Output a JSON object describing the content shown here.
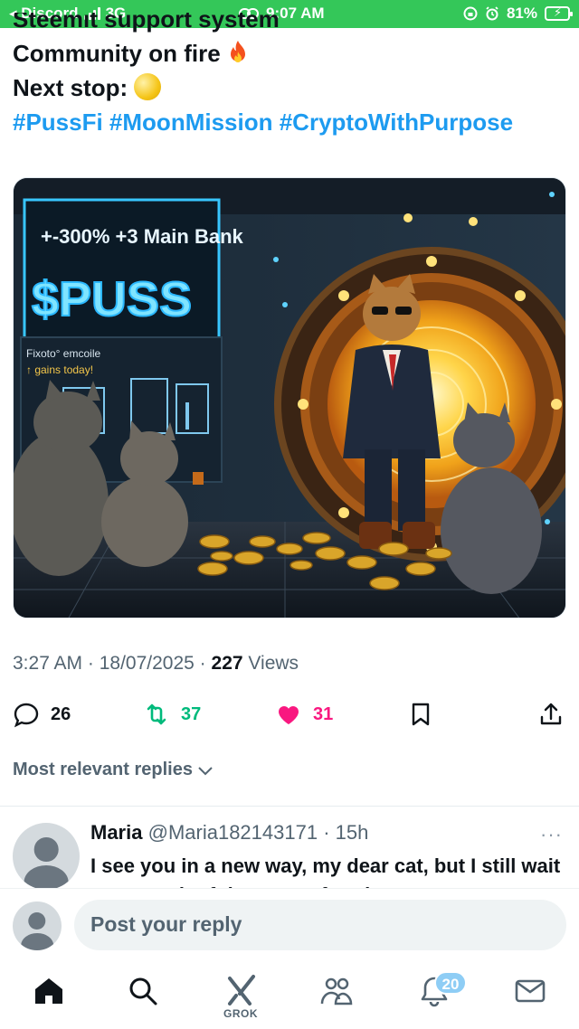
{
  "status_bar": {
    "back_app": "◂ Discord",
    "network": "3G",
    "time": "9:07 AM",
    "battery": "81%",
    "color": "#34c759"
  },
  "tweet": {
    "cut_line": "Steemit support system",
    "line1": "Community on fire",
    "line2": "Next stop:",
    "hashtags": "#PussFi #MoonMission #CryptoWithPurpose"
  },
  "media": {
    "sign_line1": "+-300% +3 Main Bank",
    "sign_line2": "$PUSS",
    "small_line1": "Fixoto° emcoile",
    "small_line2": "↑ gains today!"
  },
  "meta": {
    "time": "3:27 AM",
    "sep1": " · ",
    "date": "18/07/2025",
    "sep2": " · ",
    "views_count": "227",
    "views_label": " Views"
  },
  "actions": {
    "replies": "26",
    "reposts": "37",
    "likes": "31",
    "repost_color": "#00ba7c",
    "like_color": "#f91880"
  },
  "replies_filter": "Most relevant replies",
  "reply": {
    "name": "Maria",
    "handle": "@Maria182143171",
    "time": " · 15h",
    "more": "···",
    "text": "I see you in a new way, my dear cat, but I still wait to try each of the taste of project"
  },
  "composer": {
    "placeholder": "Post your reply"
  },
  "tabbar": {
    "grok_label": "GROK",
    "notifications_badge": "20",
    "icons": [
      "home-icon",
      "search-icon",
      "grok-icon",
      "communities-icon",
      "notifications-icon",
      "messages-icon"
    ]
  }
}
